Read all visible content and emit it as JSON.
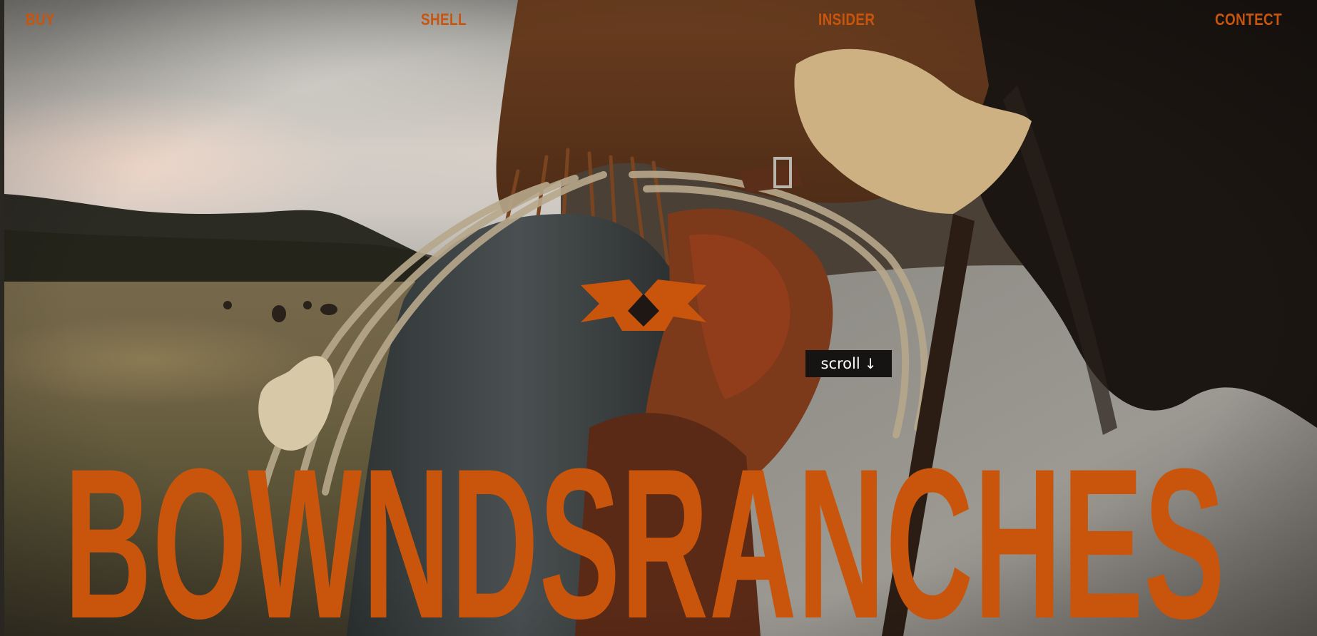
{
  "nav": {
    "items": [
      {
        "label": "BUY"
      },
      {
        "label": "SHELL"
      },
      {
        "label": "INSIDER"
      },
      {
        "label": "CONTECT"
      }
    ]
  },
  "hero": {
    "wordmark": "BOWNDSRANCHES",
    "scroll_label": "scroll",
    "scroll_arrow": "↓"
  },
  "logo": {
    "icon": "ranch-brand-icon"
  },
  "colors": {
    "accent": "#c8550b",
    "scroll_bg": "#161412",
    "scroll_text": "#ffffff"
  }
}
